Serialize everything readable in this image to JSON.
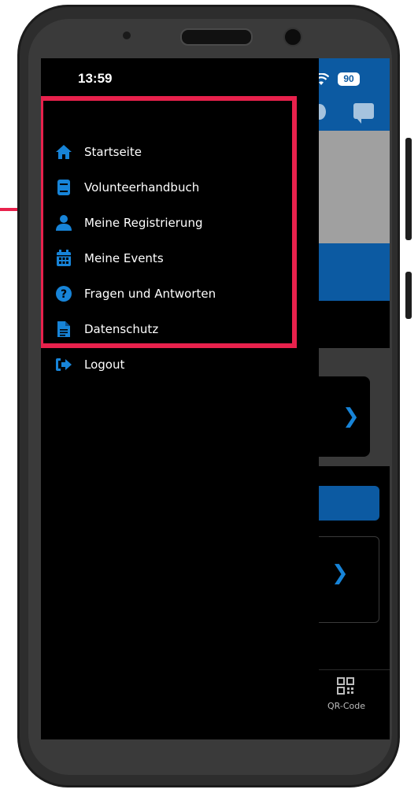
{
  "status_bar": {
    "time": "13:59",
    "battery": "90"
  },
  "drawer_menu": {
    "items": [
      {
        "label": "Startseite",
        "icon": "home-icon"
      },
      {
        "label": "Volunteerhandbuch",
        "icon": "book-icon"
      },
      {
        "label": "Meine Registrierung",
        "icon": "user-icon"
      },
      {
        "label": "Meine Events",
        "icon": "calendar-icon"
      },
      {
        "label": "Fragen und Antworten",
        "icon": "question-circle-icon"
      },
      {
        "label": "Datenschutz",
        "icon": "document-icon"
      },
      {
        "label": "Logout",
        "icon": "logout-icon"
      }
    ]
  },
  "background_app": {
    "bottom_nav_qr_label": "QR-Code"
  },
  "colors": {
    "accent_blue": "#1784d8",
    "header_blue": "#0c5aa2",
    "highlight_red": "#e8214c",
    "drawer_bg": "#000000"
  }
}
